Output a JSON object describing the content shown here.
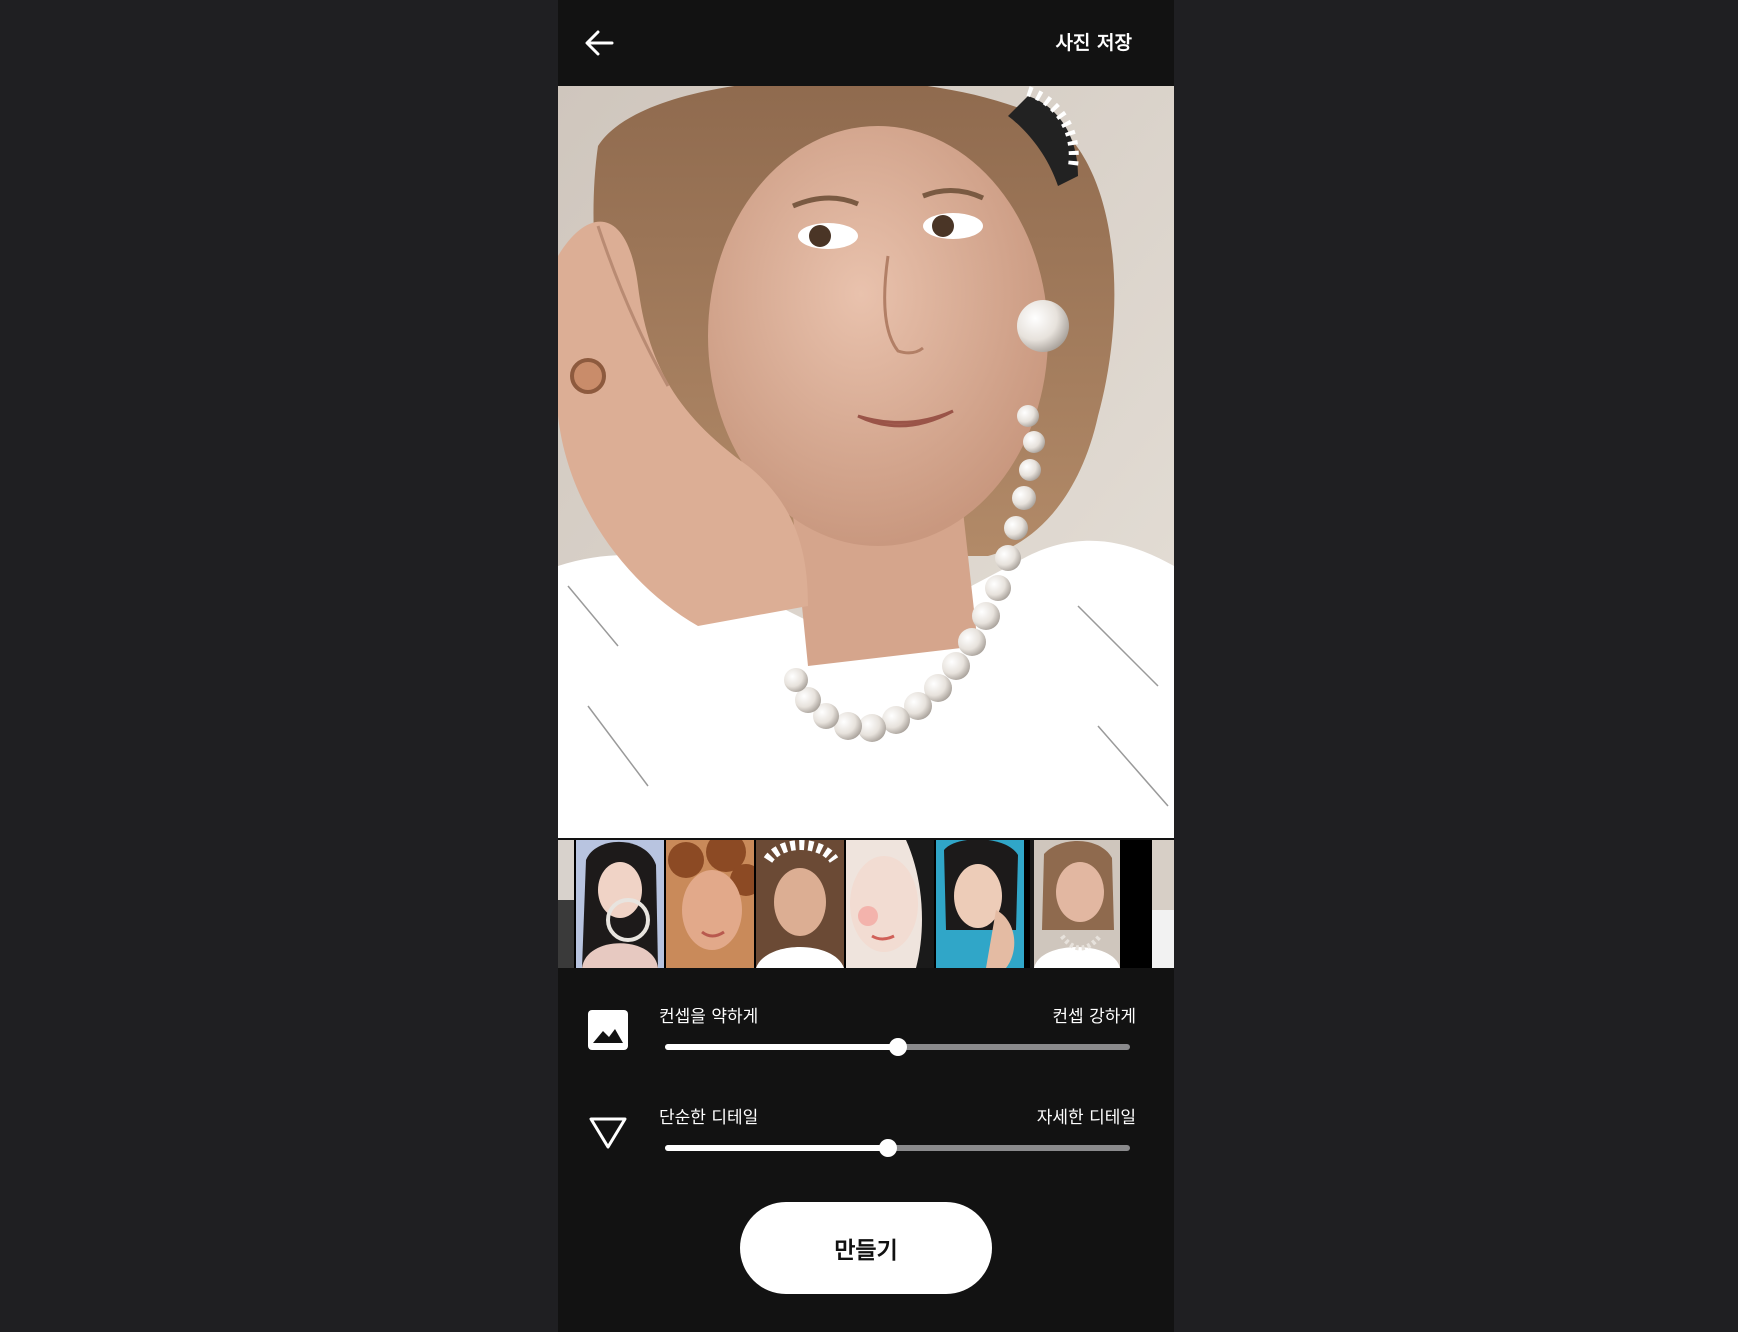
{
  "header": {
    "back_icon": "arrow-left-icon",
    "save_label": "사진 저장"
  },
  "colors": {
    "background": "#1f1f22",
    "panel": "#121212",
    "accent": "#ffffff",
    "track_inactive": "#8a8a8c"
  },
  "thumbnails": [
    {
      "name": "thumbnail-partial-left"
    },
    {
      "name": "thumbnail-1",
      "selected": true
    },
    {
      "name": "thumbnail-2"
    },
    {
      "name": "thumbnail-3"
    },
    {
      "name": "thumbnail-4"
    },
    {
      "name": "thumbnail-5"
    },
    {
      "name": "thumbnail-6"
    },
    {
      "name": "thumbnail-partial-right"
    }
  ],
  "sliders": {
    "concept": {
      "icon": "image-icon",
      "left_label": "컨셉을 약하게",
      "right_label": "컨셉 강하게",
      "value": 0.5
    },
    "detail": {
      "icon": "triangle-down-icon",
      "left_label": "단순한 디테일",
      "right_label": "자세한 디테일",
      "value": 0.48
    }
  },
  "make_button_label": "만들기"
}
